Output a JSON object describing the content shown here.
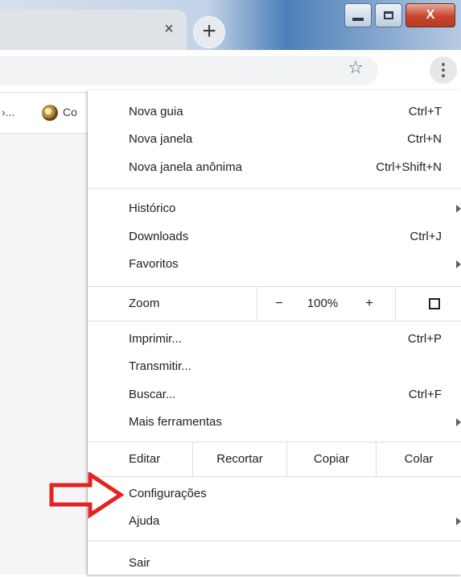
{
  "tab": {
    "close_glyph": "×"
  },
  "newtab": {
    "glyph": "+"
  },
  "window": {
    "close_glyph": "X"
  },
  "toolbar": {
    "star_icon": "star-icon",
    "menu_icon": "vertical-dots-icon"
  },
  "bookmarks": {
    "truncated_left": "›...",
    "item_label": "Co"
  },
  "menu": {
    "group1": [
      {
        "label": "Nova guia",
        "shortcut": "Ctrl+T"
      },
      {
        "label": "Nova janela",
        "shortcut": "Ctrl+N"
      },
      {
        "label": "Nova janela anônima",
        "shortcut": "Ctrl+Shift+N"
      }
    ],
    "group2": [
      {
        "label": "Histórico",
        "shortcut": ""
      },
      {
        "label": "Downloads",
        "shortcut": "Ctrl+J"
      },
      {
        "label": "Favoritos",
        "shortcut": ""
      }
    ],
    "zoom": {
      "label": "Zoom",
      "minus": "−",
      "value": "100%",
      "plus": "+"
    },
    "group3": [
      {
        "label": "Imprimir...",
        "shortcut": "Ctrl+P"
      },
      {
        "label": "Transmitir...",
        "shortcut": ""
      },
      {
        "label": "Buscar...",
        "shortcut": "Ctrl+F"
      },
      {
        "label": "Mais ferramentas",
        "shortcut": ""
      }
    ],
    "edit": {
      "label": "Editar",
      "cut": "Recortar",
      "copy": "Copiar",
      "paste": "Colar"
    },
    "group4": [
      {
        "label": "Configurações"
      },
      {
        "label": "Ajuda"
      }
    ],
    "exit": {
      "label": "Sair"
    }
  },
  "annotation": {
    "arrow_color": "#e32222"
  }
}
